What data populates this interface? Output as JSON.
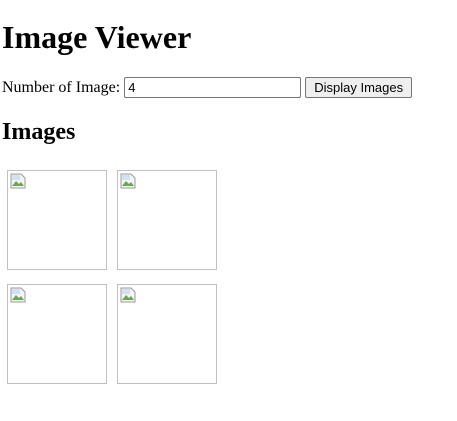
{
  "page": {
    "title": "Image Viewer",
    "section_heading": "Images"
  },
  "controls": {
    "label": "Number of Image:",
    "input_value": "4",
    "button_label": "Display Images"
  },
  "images": [
    {
      "icon": "broken-image-icon"
    },
    {
      "icon": "broken-image-icon"
    },
    {
      "icon": "broken-image-icon"
    },
    {
      "icon": "broken-image-icon"
    }
  ]
}
